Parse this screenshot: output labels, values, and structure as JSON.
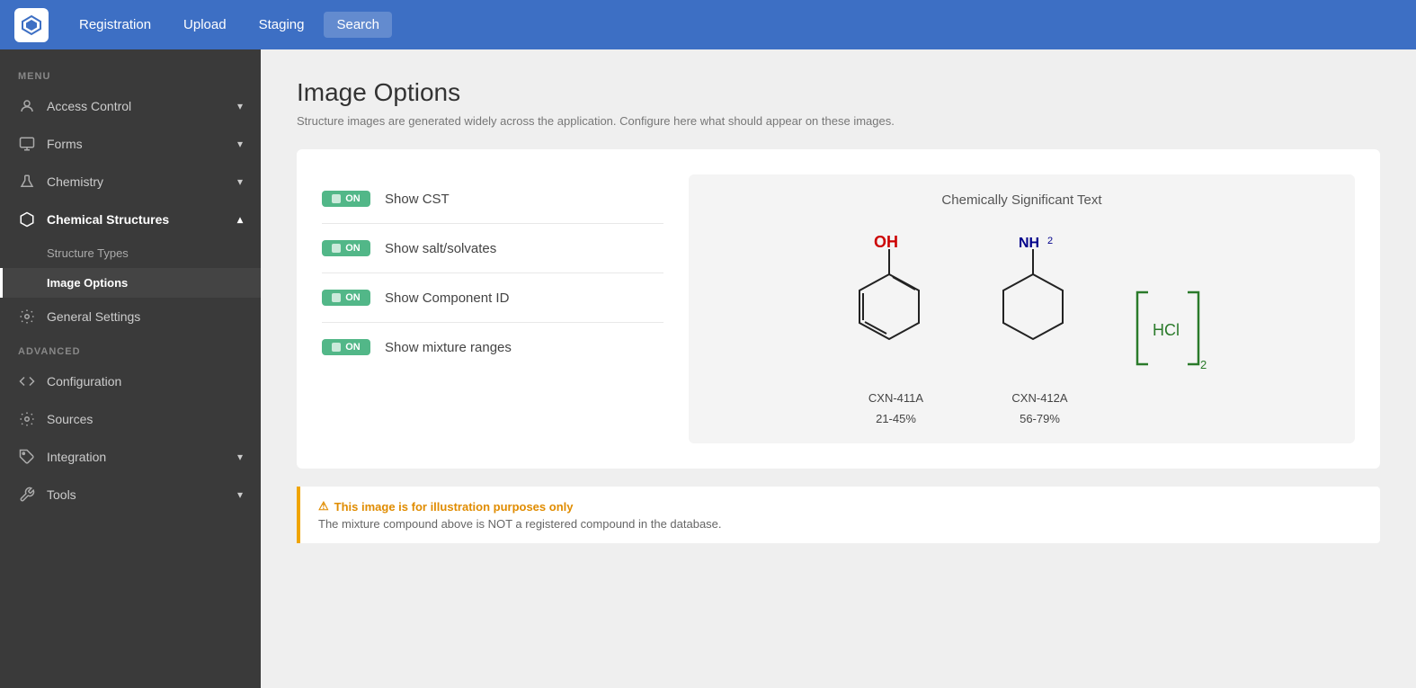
{
  "app": {
    "logo_alt": "App Logo"
  },
  "top_nav": {
    "links": [
      {
        "label": "Registration",
        "active": false
      },
      {
        "label": "Upload",
        "active": false
      },
      {
        "label": "Staging",
        "active": false
      },
      {
        "label": "Search",
        "active": true
      }
    ]
  },
  "sidebar": {
    "menu_label": "MENU",
    "advanced_label": "ADVANCED",
    "items": [
      {
        "id": "access-control",
        "label": "Access Control",
        "icon": "person",
        "has_chevron": true
      },
      {
        "id": "forms",
        "label": "Forms",
        "icon": "monitor",
        "has_chevron": true
      },
      {
        "id": "chemistry",
        "label": "Chemistry",
        "icon": "flask",
        "has_chevron": true
      },
      {
        "id": "chemical-structures",
        "label": "Chemical Structures",
        "icon": "hexagon",
        "has_chevron": true,
        "active": true
      }
    ],
    "sub_items": [
      {
        "id": "structure-types",
        "label": "Structure Types"
      },
      {
        "id": "image-options",
        "label": "Image Options",
        "active": true
      }
    ],
    "advanced_items": [
      {
        "id": "general-settings",
        "label": "General Settings",
        "icon": "gear",
        "has_chevron": false
      },
      {
        "id": "configuration",
        "label": "Configuration",
        "icon": "code",
        "has_chevron": false
      },
      {
        "id": "sources",
        "label": "Sources",
        "icon": "sprocket",
        "has_chevron": false
      },
      {
        "id": "integration",
        "label": "Integration",
        "icon": "puzzle",
        "has_chevron": true
      },
      {
        "id": "tools",
        "label": "Tools",
        "icon": "wrench",
        "has_chevron": true
      }
    ]
  },
  "page": {
    "title": "Image Options",
    "subtitle": "Structure images are generated widely across the application. Configure here what should appear on these images."
  },
  "options": [
    {
      "id": "show-cst",
      "label": "Show CST",
      "toggle": "ON"
    },
    {
      "id": "show-salt",
      "label": "Show salt/solvates",
      "toggle": "ON"
    },
    {
      "id": "show-component-id",
      "label": "Show Component ID",
      "toggle": "ON"
    },
    {
      "id": "show-mixture-ranges",
      "label": "Show mixture ranges",
      "toggle": "ON"
    }
  ],
  "preview": {
    "title": "Chemically Significant Text",
    "molecules": [
      {
        "id": "cxn-411a",
        "label": "CXN-411A",
        "range": "21-45%"
      },
      {
        "id": "cxn-412a",
        "label": "CXN-412A",
        "range": "56-79%"
      },
      {
        "id": "hcl",
        "label": "",
        "range": ""
      }
    ]
  },
  "warning": {
    "icon": "⚠",
    "title": "This image is for illustration purposes only",
    "text": "The mixture compound above is NOT a registered compound in the database."
  }
}
